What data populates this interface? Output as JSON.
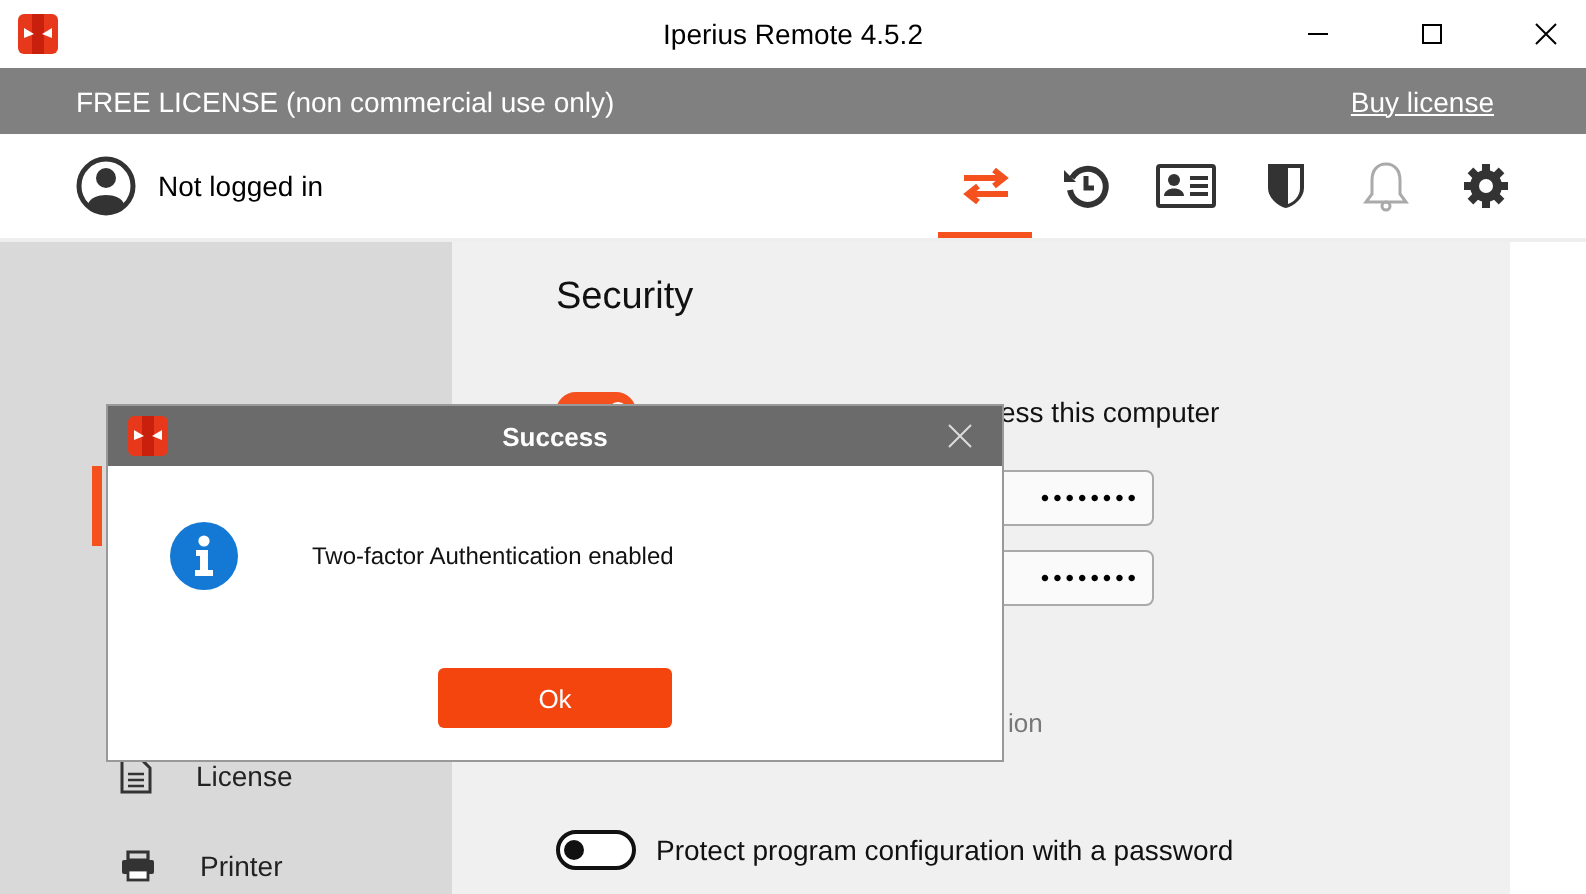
{
  "window": {
    "title": "Iperius Remote 4.5.2"
  },
  "license_bar": {
    "text": "FREE LICENSE (non commercial use only)",
    "link": "Buy license"
  },
  "account": {
    "status": "Not logged in"
  },
  "toolbar": [
    {
      "kind": "connect",
      "selected": true,
      "disabled": false
    },
    {
      "kind": "history",
      "selected": false,
      "disabled": false
    },
    {
      "kind": "contacts",
      "selected": false,
      "disabled": false
    },
    {
      "kind": "security",
      "selected": false,
      "disabled": false
    },
    {
      "kind": "notifications",
      "selected": false,
      "disabled": true
    },
    {
      "kind": "settings",
      "selected": false,
      "disabled": false
    }
  ],
  "sidebar": {
    "items": [
      {
        "kind": "covered",
        "selected": true
      },
      {
        "kind": "license",
        "label": "License",
        "selected": false
      },
      {
        "kind": "printer",
        "label": "Printer",
        "selected": false
      }
    ]
  },
  "security": {
    "title": "Security",
    "options": [
      {
        "kind": "toggle",
        "label": "ess this computer",
        "on": true
      },
      {
        "kind": "password",
        "value": "••••••••"
      },
      {
        "kind": "password",
        "value": "••••••••"
      },
      {
        "kind": "note",
        "label": "ion"
      },
      {
        "kind": "toggle",
        "label": "Protect program configuration with a password",
        "on": false
      }
    ]
  },
  "dialog": {
    "title": "Success",
    "message": "Two-factor Authentication enabled",
    "button": "Ok"
  }
}
